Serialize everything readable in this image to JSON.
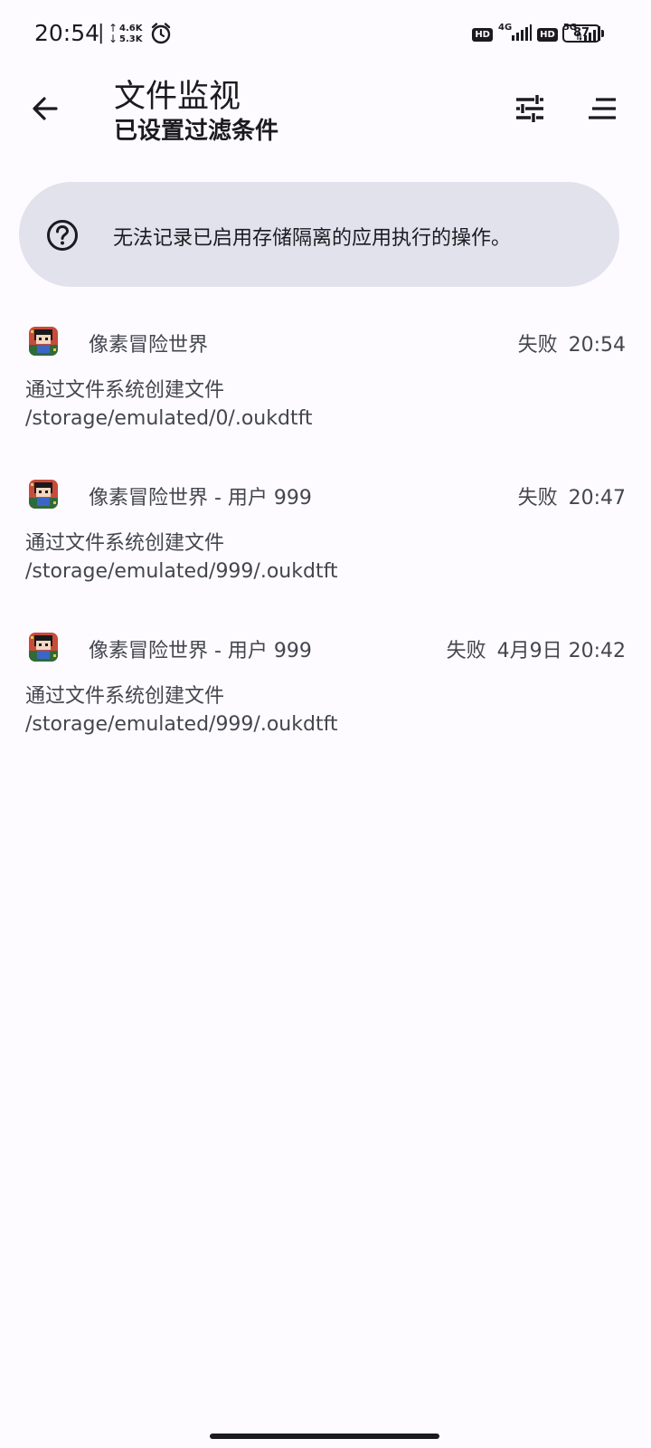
{
  "status_bar": {
    "time": "20:54",
    "separator": "|",
    "speed_up": "4.6K",
    "speed_down": "5.3K",
    "hd1": "HD",
    "net1": "4G",
    "hd2": "HD",
    "net2": "5G",
    "battery": "87"
  },
  "appbar": {
    "title": "文件监视",
    "subtitle": "已设置过滤条件"
  },
  "info": {
    "text": "无法记录已启用存储隔离的应用执行的操作。"
  },
  "entries": [
    {
      "app": "像素冒险世界",
      "status": "失败",
      "time": "20:54",
      "op": "通过文件系统创建文件",
      "path": "/storage/emulated/0/.oukdtft"
    },
    {
      "app": "像素冒险世界 - 用户 999",
      "status": "失败",
      "time": "20:47",
      "op": "通过文件系统创建文件",
      "path": "/storage/emulated/999/.oukdtft"
    },
    {
      "app": "像素冒险世界 - 用户 999",
      "status": "失败",
      "time": "4月9日 20:42",
      "op": "通过文件系统创建文件",
      "path": "/storage/emulated/999/.oukdtft"
    }
  ],
  "colors": {
    "background": "#fdfbff",
    "card": "#e1e2ec",
    "text_primary": "#1b1b1f",
    "text_secondary": "#44464f"
  }
}
